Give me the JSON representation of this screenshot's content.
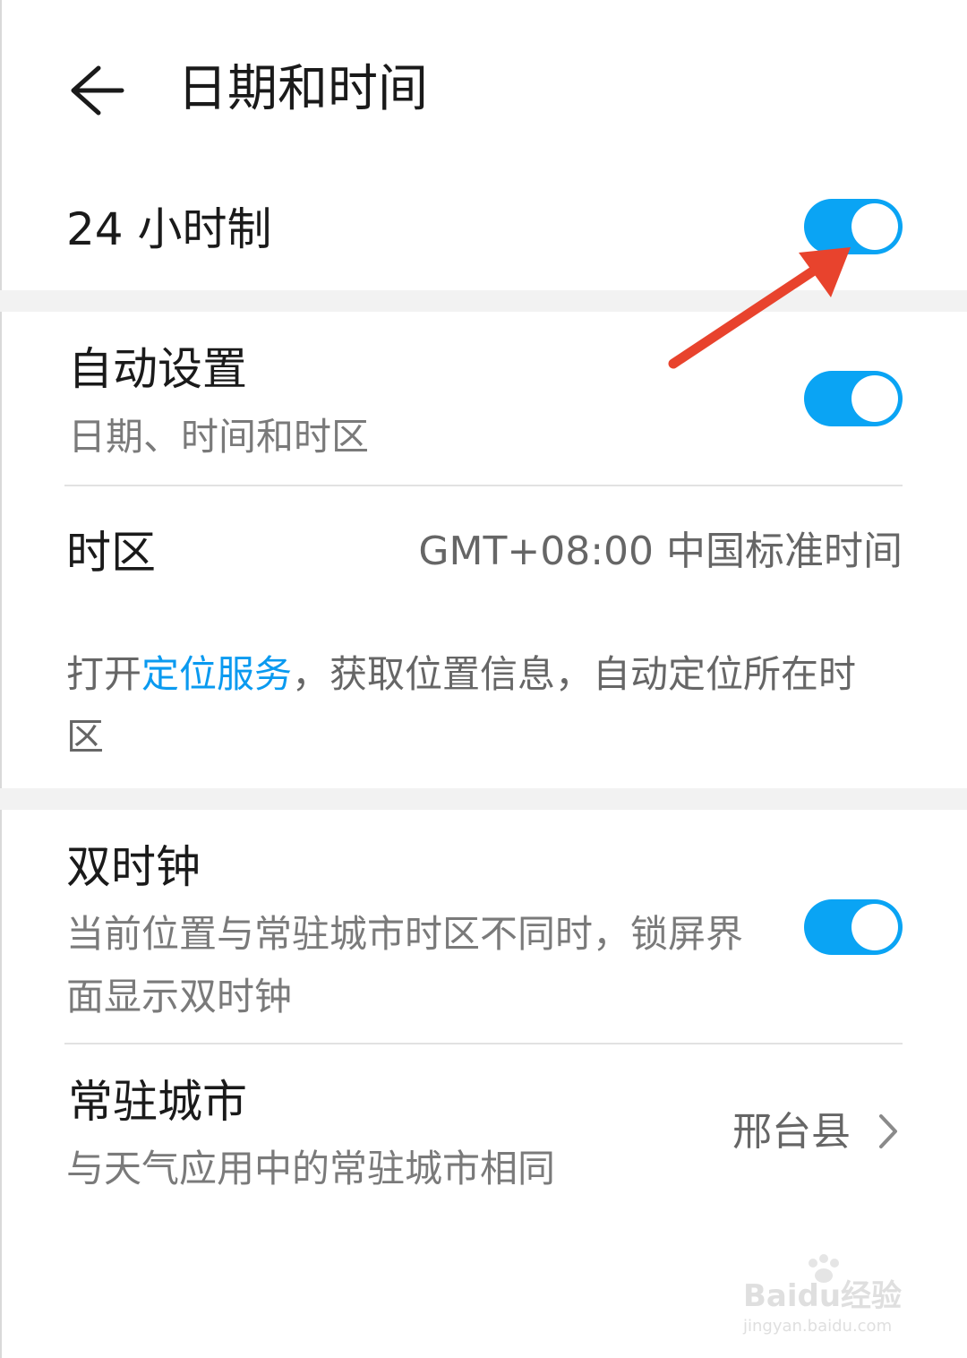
{
  "header": {
    "title": "日期和时间",
    "back_icon": "arrow-left-icon"
  },
  "hour24": {
    "label": "24 小时制",
    "enabled": true
  },
  "auto_set": {
    "label": "自动设置",
    "subtitle": "日期、时间和时区",
    "enabled": true
  },
  "timezone": {
    "label": "时区",
    "value": "GMT+08:00 中国标准时间",
    "hint_prefix": "打开",
    "hint_link": "定位服务",
    "hint_suffix": "，获取位置信息，自动定位所在时区"
  },
  "dual_clock": {
    "label": "双时钟",
    "subtitle": "当前位置与常驻城市时区不同时，锁屏界面显示双时钟",
    "enabled": true
  },
  "home_city": {
    "label": "常驻城市",
    "subtitle": "与天气应用中的常驻城市相同",
    "value": "邢台县",
    "chevron_icon": "chevron-right-icon"
  },
  "watermark": {
    "brand": "Baidu经验",
    "url": "jingyan.baidu.com"
  },
  "colors": {
    "accent": "#0aa4f4",
    "link": "#0a9af0",
    "annotation_arrow": "#e8432d"
  }
}
